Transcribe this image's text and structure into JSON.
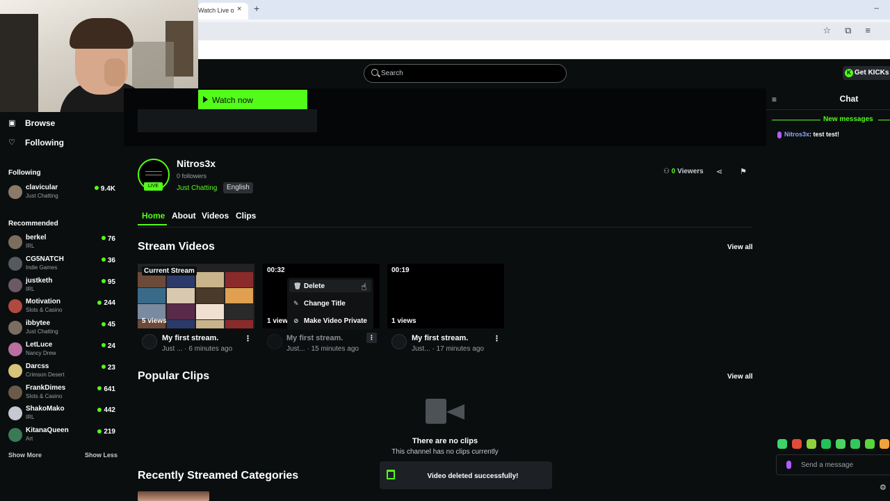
{
  "browser": {
    "tab_title": "Watch Live o",
    "tab_close": "×",
    "new_tab": "+",
    "minimize": "–"
  },
  "header": {
    "search_placeholder": "Search",
    "get_kicks_label": "Get KICKs"
  },
  "sidebar": {
    "nav": [
      {
        "label": "Browse",
        "icon": "browse-icon"
      },
      {
        "label": "Following",
        "icon": "heart-icon"
      }
    ],
    "following_title": "Following",
    "following": [
      {
        "name": "clavicular",
        "category": "Just Chatting",
        "viewers": "9.4K",
        "color": "#8a7a6a"
      }
    ],
    "recommended_title": "Recommended",
    "recommended": [
      {
        "name": "berkel",
        "category": "IRL",
        "viewers": "76",
        "color": "#7a6e5f"
      },
      {
        "name": "CG5NATCH",
        "category": "Indie Games",
        "viewers": "36",
        "color": "#555a5e"
      },
      {
        "name": "justketh",
        "category": "IRL",
        "viewers": "95",
        "color": "#6b5a66"
      },
      {
        "name": "Motivation",
        "category": "Slots & Casino",
        "viewers": "244",
        "color": "#b0493f"
      },
      {
        "name": "ibbytee",
        "category": "Just Chatting",
        "viewers": "45",
        "color": "#7a6e60"
      },
      {
        "name": "LetLuce",
        "category": "Nancy Drew",
        "viewers": "24",
        "color": "#b96fa0"
      },
      {
        "name": "Darcss",
        "category": "Crimson Desert",
        "viewers": "23",
        "color": "#d8c37a"
      },
      {
        "name": "FrankDimes",
        "category": "Slots & Casino",
        "viewers": "641",
        "color": "#6a5a4a"
      },
      {
        "name": "ShakoMako",
        "category": "IRL",
        "viewers": "442",
        "color": "#c8c8d0"
      },
      {
        "name": "KitanaQueen",
        "category": "Art",
        "viewers": "219",
        "color": "#3a7a54"
      }
    ],
    "show_more": "Show More",
    "show_less": "Show Less"
  },
  "banner": {
    "watch_now": "Watch now"
  },
  "channel": {
    "name": "Nitros3x",
    "followers": "0 followers",
    "live_badge": "LIVE",
    "category": "Just Chatting",
    "language": "English",
    "viewers_count": "0",
    "viewers_label": "Viewers"
  },
  "tabs": [
    "Home",
    "About",
    "Videos",
    "Clips"
  ],
  "stream_videos": {
    "title": "Stream Videos",
    "view_all": "View all",
    "items": [
      {
        "badge": "Current Stream",
        "views": "5 views",
        "title": "My first stream.",
        "channel": "Just ...",
        "time": "6 minutes ago"
      },
      {
        "badge": "00:32",
        "views": "1 views",
        "title": "My first stream.",
        "channel": "Just...",
        "time": "15 minutes ago"
      },
      {
        "badge": "00:19",
        "views": "1 views",
        "title": "My first stream.",
        "channel": "Just...",
        "time": "17 minutes ago"
      }
    ]
  },
  "context_menu": {
    "items": [
      {
        "label": "Delete",
        "icon": "trash-icon"
      },
      {
        "label": "Change Title",
        "icon": "pencil-icon"
      },
      {
        "label": "Make Video Private",
        "icon": "eye-off-icon"
      }
    ]
  },
  "popular_clips": {
    "title": "Popular Clips",
    "view_all": "View all",
    "empty_title": "There are no clips",
    "empty_sub": "This channel has no clips currently"
  },
  "recent_categories": {
    "title": "Recently Streamed Categories"
  },
  "toast": {
    "message": "Video deleted successfully!"
  },
  "chat": {
    "title": "Chat",
    "new_messages": "New messages",
    "messages": [
      {
        "user": "Nitros3x",
        "text": ": test test!"
      }
    ],
    "input_placeholder": "Send a message",
    "emote_colors": [
      "#3bd46b",
      "#e04b3a",
      "#8fd13b",
      "#22c25a",
      "#4bd45e",
      "#34c85a",
      "#5ad63c",
      "#f0a33a"
    ]
  },
  "colors": {
    "accent": "#53fc18",
    "background": "#0b0e0f"
  }
}
